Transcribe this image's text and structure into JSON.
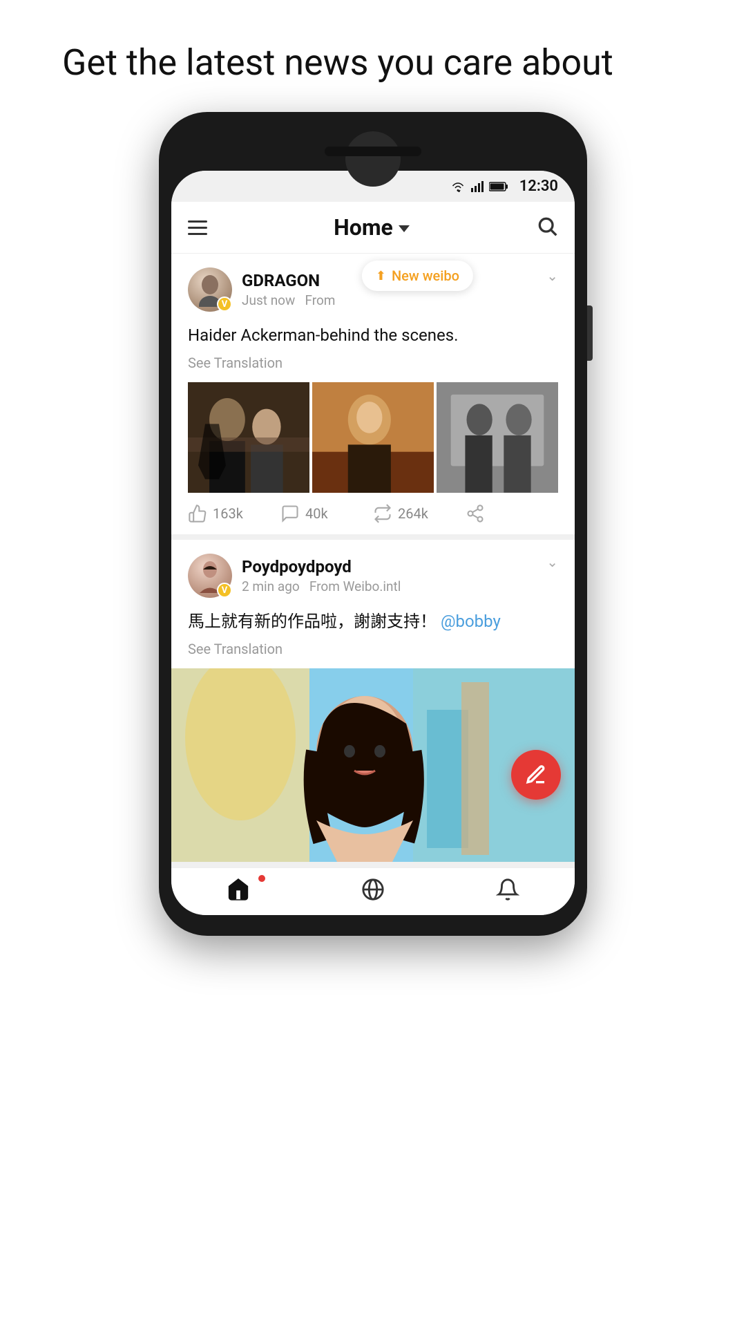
{
  "page": {
    "headline": "Get the latest news you care about"
  },
  "status_bar": {
    "time": "12:30"
  },
  "header": {
    "title": "Home",
    "menu_label": "menu",
    "search_label": "search"
  },
  "new_weibo_badge": {
    "label": "New weibo",
    "arrow": "↑"
  },
  "posts": [
    {
      "id": "post1",
      "username": "GDRAGON",
      "time": "Just now",
      "source": "From",
      "text": "Haider Ackerman-behind the scenes.",
      "see_translation": "See Translation",
      "likes": "163k",
      "comments": "40k",
      "reposts": "264k",
      "vip": "V"
    },
    {
      "id": "post2",
      "username": "Poydpoydpoyd",
      "time": "2 min ago",
      "source": "From Weibo.intl",
      "text": "馬上就有新的作品啦，謝謝支持！",
      "mention": "@bobby",
      "see_translation": "See Translation",
      "vip": "V"
    }
  ],
  "nav": {
    "home_label": "home",
    "explore_label": "explore",
    "notifications_label": "notifications",
    "has_dot": true
  },
  "fab": {
    "label": "compose"
  }
}
